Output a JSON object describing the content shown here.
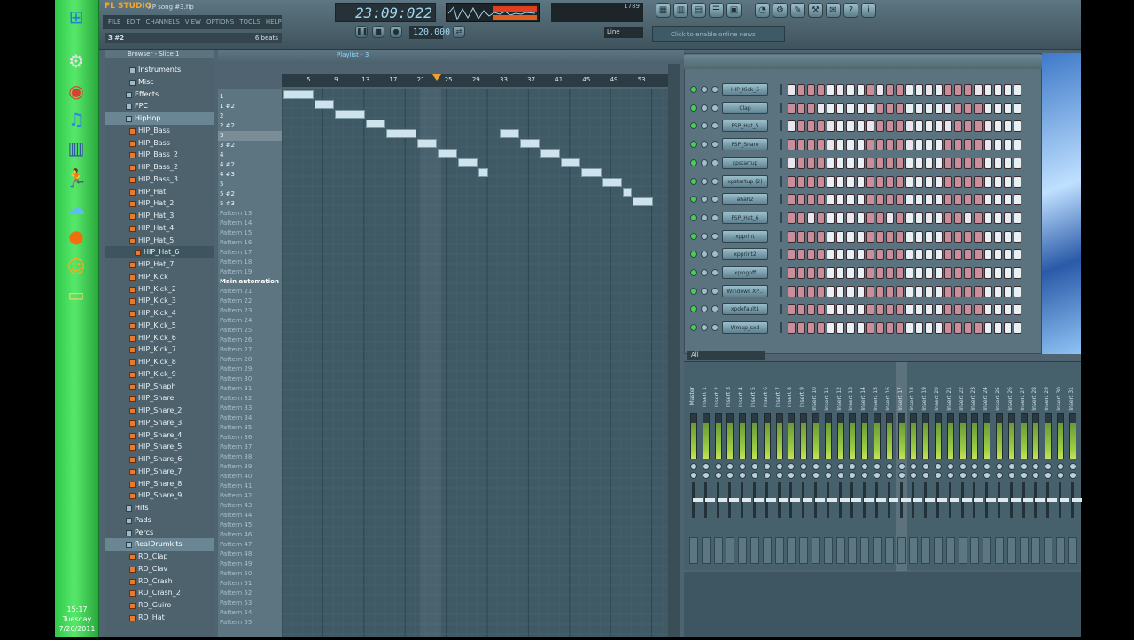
{
  "taskbar": {
    "clock": {
      "time": "15:17",
      "day": "Tuesday",
      "date": "7/26/2011"
    },
    "icons": [
      "windows-orb-icon",
      "settings-icon",
      "chrome-icon",
      "itunes-icon",
      "equalizer-icon",
      "aim-running-man-icon",
      "network-icon",
      "record-icon",
      "messenger-icon",
      "folder-icon"
    ]
  },
  "app": {
    "logo": "FL STUDIO",
    "song_title": "XP song #3.flp",
    "menu": [
      "FILE",
      "EDIT",
      "CHANNELS",
      "VIEW",
      "OPTIONS",
      "TOOLS",
      "HELP"
    ],
    "time_display": "23:09:022",
    "tempo": "120.000",
    "line_mode": "Line",
    "hint": "Click to enable online news",
    "cpu_label": "1789"
  },
  "pattern_path": {
    "name": "3 #2",
    "length": "6 beats"
  },
  "browser": {
    "title": "Browser - Slice 1",
    "items": [
      {
        "label": "Instruments",
        "type": "folder",
        "indent": 2
      },
      {
        "label": "Misc",
        "type": "folder",
        "indent": 2
      },
      {
        "label": "Effects",
        "type": "folder",
        "indent": 1
      },
      {
        "label": "FPC",
        "type": "folder",
        "indent": 1
      },
      {
        "label": "HipHop",
        "type": "folder",
        "indent": 1,
        "sel": true
      },
      {
        "label": "HIP_Bass",
        "type": "sample",
        "indent": 2
      },
      {
        "label": "HIP_Bass",
        "type": "sample",
        "indent": 2
      },
      {
        "label": "HIP_Bass_2",
        "type": "sample",
        "indent": 2
      },
      {
        "label": "HIP_Bass_2",
        "type": "sample",
        "indent": 2
      },
      {
        "label": "HIP_Bass_3",
        "type": "sample",
        "indent": 2
      },
      {
        "label": "HIP_Hat",
        "type": "sample",
        "indent": 2
      },
      {
        "label": "HIP_Hat_2",
        "type": "sample",
        "indent": 2
      },
      {
        "label": "HIP_Hat_3",
        "type": "sample",
        "indent": 2
      },
      {
        "label": "HIP_Hat_4",
        "type": "sample",
        "indent": 2
      },
      {
        "label": "HIP_Hat_5",
        "type": "sample",
        "indent": 2
      },
      {
        "label": "HIP_Hat_6",
        "type": "sample",
        "indent": 3,
        "sel2": true
      },
      {
        "label": "HIP_Hat_7",
        "type": "sample",
        "indent": 2
      },
      {
        "label": "HIP_Kick",
        "type": "sample",
        "indent": 2
      },
      {
        "label": "HIP_Kick_2",
        "type": "sample",
        "indent": 2
      },
      {
        "label": "HIP_Kick_3",
        "type": "sample",
        "indent": 2
      },
      {
        "label": "HIP_Kick_4",
        "type": "sample",
        "indent": 2
      },
      {
        "label": "HIP_Kick_5",
        "type": "sample",
        "indent": 2
      },
      {
        "label": "HIP_Kick_6",
        "type": "sample",
        "indent": 2
      },
      {
        "label": "HIP_Kick_7",
        "type": "sample",
        "indent": 2
      },
      {
        "label": "HIP_Kick_8",
        "type": "sample",
        "indent": 2
      },
      {
        "label": "HIP_Kick_9",
        "type": "sample",
        "indent": 2
      },
      {
        "label": "HIP_Snaph",
        "type": "sample",
        "indent": 2
      },
      {
        "label": "HIP_Snare",
        "type": "sample",
        "indent": 2
      },
      {
        "label": "HIP_Snare_2",
        "type": "sample",
        "indent": 2
      },
      {
        "label": "HIP_Snare_3",
        "type": "sample",
        "indent": 2
      },
      {
        "label": "HIP_Snare_4",
        "type": "sample",
        "indent": 2
      },
      {
        "label": "HIP_Snare_5",
        "type": "sample",
        "indent": 2
      },
      {
        "label": "HIP_Snare_6",
        "type": "sample",
        "indent": 2
      },
      {
        "label": "HIP_Snare_7",
        "type": "sample",
        "indent": 2
      },
      {
        "label": "HIP_Snare_8",
        "type": "sample",
        "indent": 2
      },
      {
        "label": "HIP_Snare_9",
        "type": "sample",
        "indent": 2
      },
      {
        "label": "Hits",
        "type": "folder",
        "indent": 1
      },
      {
        "label": "Pads",
        "type": "folder",
        "indent": 1
      },
      {
        "label": "Percs",
        "type": "folder",
        "indent": 1
      },
      {
        "label": "RealDrumkits",
        "type": "folder",
        "indent": 1,
        "sel": true
      },
      {
        "label": "RD_Clap",
        "type": "sample",
        "indent": 2
      },
      {
        "label": "RD_Clav",
        "type": "sample",
        "indent": 2
      },
      {
        "label": "RD_Crash",
        "type": "sample",
        "indent": 2
      },
      {
        "label": "RD_Crash_2",
        "type": "sample",
        "indent": 2
      },
      {
        "label": "RD_Guiro",
        "type": "sample",
        "indent": 2
      },
      {
        "label": "RD_Hat",
        "type": "sample",
        "indent": 2
      }
    ]
  },
  "playlist": {
    "title": "Playlist - 3",
    "timeline": [
      "5",
      "9",
      "13",
      "17",
      "21",
      "25",
      "29",
      "33",
      "37",
      "41",
      "45",
      "49",
      "53"
    ],
    "patterns": [
      "1",
      "1 #2",
      "2",
      "2 #2",
      "3",
      "3 #2",
      "4",
      "4 #2",
      "4 #3",
      "5",
      "5 #2",
      "5 #3",
      "Pattern 13",
      "Pattern 14",
      "Pattern 15",
      "Pattern 16",
      "Pattern 17",
      "Pattern 18",
      "Pattern 19",
      "Main automation",
      "Pattern 21",
      "Pattern 22",
      "Pattern 23",
      "Pattern 24",
      "Pattern 25",
      "Pattern 26",
      "Pattern 27",
      "Pattern 28",
      "Pattern 29",
      "Pattern 30",
      "Pattern 31",
      "Pattern 32",
      "Pattern 33",
      "Pattern 34",
      "Pattern 35",
      "Pattern 36",
      "Pattern 37",
      "Pattern 38",
      "Pattern 39",
      "Pattern 40",
      "Pattern 41",
      "Pattern 42",
      "Pattern 43",
      "Pattern 44",
      "Pattern 45",
      "Pattern 46",
      "Pattern 47",
      "Pattern 48",
      "Pattern 49",
      "Pattern 50",
      "Pattern 51",
      "Pattern 52",
      "Pattern 53",
      "Pattern 54",
      "Pattern 55"
    ],
    "blocks": [
      {
        "row": 0,
        "start": 1,
        "len": 3
      },
      {
        "row": 1,
        "start": 4,
        "len": 2
      },
      {
        "row": 2,
        "start": 6,
        "len": 3
      },
      {
        "row": 3,
        "start": 9,
        "len": 2
      },
      {
        "row": 4,
        "start": 11,
        "len": 3
      },
      {
        "row": 4,
        "start": 22,
        "len": 2
      },
      {
        "row": 5,
        "start": 14,
        "len": 2
      },
      {
        "row": 5,
        "start": 24,
        "len": 2
      },
      {
        "row": 6,
        "start": 16,
        "len": 2
      },
      {
        "row": 6,
        "start": 26,
        "len": 2
      },
      {
        "row": 7,
        "start": 18,
        "len": 2
      },
      {
        "row": 7,
        "start": 28,
        "len": 2
      },
      {
        "row": 8,
        "start": 20,
        "len": 1
      },
      {
        "row": 8,
        "start": 30,
        "len": 2
      },
      {
        "row": 9,
        "start": 32,
        "len": 2
      },
      {
        "row": 10,
        "start": 34,
        "len": 1
      },
      {
        "row": 11,
        "start": 35,
        "len": 2
      }
    ]
  },
  "channel_rack": {
    "filter": "All",
    "channels": [
      {
        "name": "HIP_Kick_5",
        "on": [
          1,
          0,
          0,
          0,
          0,
          1,
          0,
          0,
          0,
          1,
          0,
          0,
          0,
          0,
          1,
          0,
          0,
          0,
          0,
          1,
          0,
          0,
          0,
          0
        ]
      },
      {
        "name": "Clap",
        "on": [
          0,
          0,
          0,
          1,
          0,
          0,
          0,
          0,
          1,
          0,
          0,
          0,
          0,
          0,
          0,
          0,
          1,
          0,
          0,
          0,
          0,
          0,
          0,
          0
        ]
      },
      {
        "name": "FSP_Hat_5",
        "on": [
          1,
          0,
          0,
          0,
          1,
          0,
          0,
          0,
          1,
          0,
          0,
          0,
          1,
          0,
          0,
          0,
          1,
          0,
          0,
          0,
          1,
          0,
          0,
          0
        ]
      },
      {
        "name": "FSP_Snare",
        "on": [
          0,
          0,
          0,
          0,
          1,
          0,
          0,
          0,
          0,
          0,
          0,
          0,
          1,
          0,
          0,
          0,
          0,
          0,
          0,
          0,
          1,
          0,
          0,
          0
        ]
      },
      {
        "name": "xpstartup",
        "on": [
          1,
          0,
          0,
          0,
          0,
          0,
          0,
          0,
          0,
          0,
          0,
          0,
          0,
          0,
          0,
          0,
          0,
          0,
          0,
          0,
          0,
          0,
          0,
          0
        ]
      },
      {
        "name": "xpstartup (2)",
        "on": [
          0,
          0,
          0,
          0,
          0,
          0,
          0,
          0,
          0,
          0,
          0,
          0,
          0,
          0,
          0,
          0,
          0,
          0,
          0,
          0,
          0,
          0,
          0,
          0
        ]
      },
      {
        "name": "ahah2",
        "on": [
          0,
          0,
          0,
          0,
          0,
          0,
          0,
          0,
          0,
          0,
          0,
          0,
          0,
          0,
          0,
          0,
          0,
          0,
          0,
          0,
          0,
          0,
          0,
          0
        ]
      },
      {
        "name": "FSP_Hat_6",
        "on": [
          0,
          0,
          1,
          0,
          0,
          0,
          1,
          0,
          0,
          0,
          1,
          0,
          0,
          0,
          1,
          0,
          0,
          0,
          1,
          0,
          0,
          0,
          1,
          0
        ]
      },
      {
        "name": "xpprint",
        "on": [
          0,
          0,
          0,
          0,
          0,
          0,
          0,
          0,
          0,
          0,
          0,
          0,
          0,
          0,
          0,
          0,
          0,
          0,
          0,
          0,
          0,
          0,
          0,
          0
        ]
      },
      {
        "name": "xpprint2",
        "on": [
          0,
          0,
          0,
          0,
          0,
          0,
          0,
          0,
          0,
          0,
          0,
          0,
          0,
          0,
          0,
          0,
          0,
          0,
          0,
          0,
          0,
          0,
          0,
          0
        ]
      },
      {
        "name": "xplogoff",
        "on": [
          0,
          0,
          0,
          0,
          0,
          0,
          0,
          0,
          0,
          0,
          0,
          0,
          0,
          0,
          0,
          0,
          0,
          0,
          0,
          0,
          0,
          0,
          0,
          0
        ]
      },
      {
        "name": "Windows XP...",
        "on": [
          0,
          0,
          0,
          0,
          0,
          0,
          0,
          0,
          0,
          0,
          0,
          0,
          0,
          0,
          0,
          0,
          0,
          0,
          0,
          0,
          0,
          0,
          0,
          0
        ]
      },
      {
        "name": "xpdefault1",
        "on": [
          0,
          0,
          0,
          0,
          0,
          0,
          0,
          0,
          0,
          0,
          0,
          0,
          0,
          0,
          0,
          0,
          0,
          0,
          0,
          0,
          0,
          0,
          0,
          0
        ]
      },
      {
        "name": "Wmap_sxd",
        "on": [
          0,
          0,
          0,
          0,
          0,
          0,
          0,
          0,
          0,
          0,
          0,
          0,
          0,
          0,
          0,
          0,
          0,
          0,
          0,
          0,
          0,
          0,
          0,
          0
        ]
      }
    ]
  },
  "mixer": {
    "tracks": [
      "Master",
      "Insert 1",
      "Insert 2",
      "Insert 3",
      "Insert 4",
      "Insert 5",
      "Insert 6",
      "Insert 7",
      "Insert 8",
      "Insert 9",
      "Insert 10",
      "Insert 11",
      "Insert 12",
      "Insert 13",
      "Insert 14",
      "Insert 15",
      "Insert 16",
      "Insert 17",
      "Insert 18",
      "Insert 19",
      "Insert 20",
      "Insert 21",
      "Insert 22",
      "Insert 23",
      "Insert 24",
      "Insert 25",
      "Insert 26",
      "Insert 27",
      "Insert 28",
      "Insert 29",
      "Insert 30",
      "Insert 31"
    ]
  }
}
